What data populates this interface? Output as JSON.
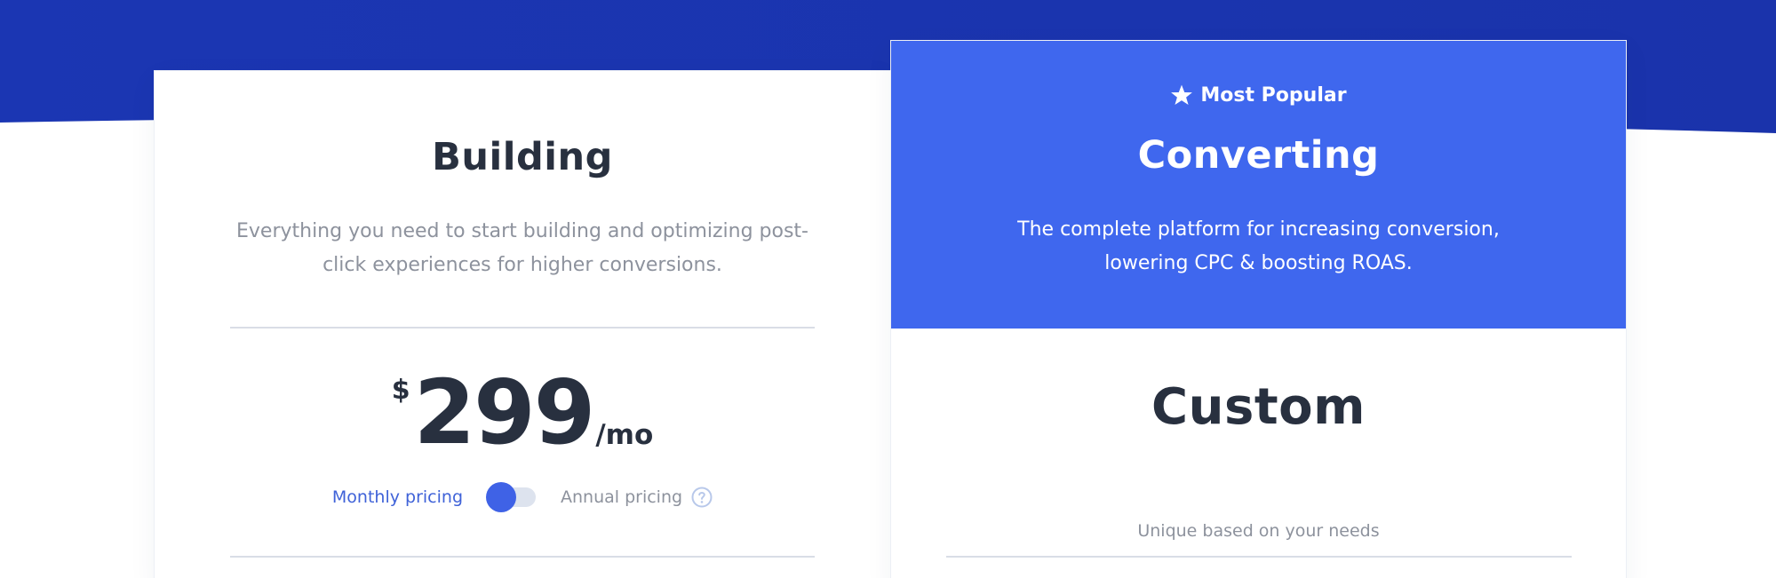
{
  "colors": {
    "hero_blue": "#1a35b0",
    "accent_blue": "#3f67ee",
    "heading_dark": "#28303f",
    "muted_gray": "#8d929d",
    "divider": "#d9dde6"
  },
  "plans": {
    "building": {
      "title": "Building",
      "description": "Everything you need to start building and optimizing post-click experiences for higher conversions.",
      "price": {
        "currency": "$",
        "amount": "299",
        "period": "/mo"
      },
      "billing_toggle": {
        "monthly_label": "Monthly pricing",
        "annual_label": "Annual pricing",
        "selected": "monthly",
        "help_icon": "question-circle-icon"
      }
    },
    "converting": {
      "badge_icon": "star-icon",
      "badge_label": "Most Popular",
      "title": "Converting",
      "description": "The complete platform for increasing conversion, lowering CPC & boosting ROAS.",
      "price_title": "Custom",
      "price_subtitle": "Unique based on your needs"
    }
  }
}
